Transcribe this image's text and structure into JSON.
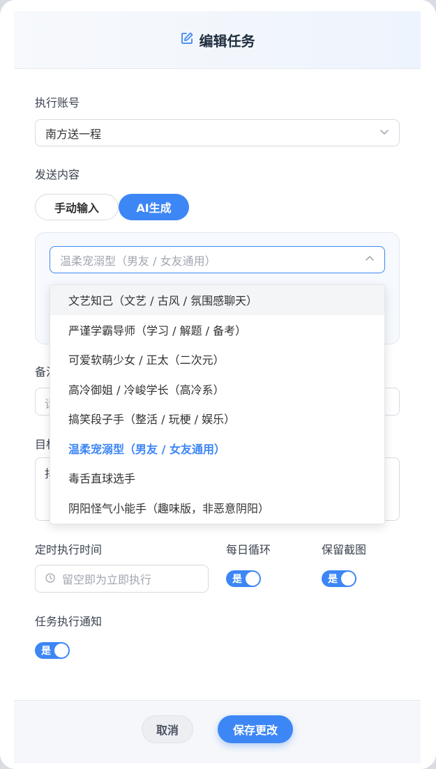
{
  "dialog": {
    "title": "编辑任务",
    "icon": "edit-icon"
  },
  "account": {
    "label": "执行账号",
    "value": "南方送一程"
  },
  "content": {
    "label": "发送内容",
    "tabs": [
      "手动输入",
      "AI生成"
    ],
    "active_tab": "AI生成"
  },
  "ai_style": {
    "placeholder": "温柔宠溺型（男友 / 女友通用）",
    "options": [
      "文艺知己（文艺 / 古风 / 氛围感聊天）",
      "严谨学霸导师（学习 / 解题 / 备考）",
      "可爱软萌少女 / 正太（二次元）",
      "高冷御姐 / 冷峻学长（高冷系）",
      "搞笑段子手（整活 / 玩梗 / 娱乐）",
      "温柔宠溺型（男友 / 女友通用）",
      "毒舌直球选手",
      "阴阳怪气小能手（趣味版，非恶意阴阳）"
    ],
    "selected": "温柔宠溺型（男友 / 女友通用）",
    "hovered": "文艺知己（文艺 / 古风 / 氛围感聊天）"
  },
  "occluded": {
    "remark_label_partial": "备注",
    "remark_input_partial": "请",
    "target_label_partial": "目标",
    "target_input_partial": "抖"
  },
  "schedule": {
    "label": "定时执行时间",
    "placeholder": "留空即为立即执行",
    "daily_loop_label": "每日循环",
    "daily_loop_value": "是",
    "keep_screenshot_label": "保留截图",
    "keep_screenshot_value": "是"
  },
  "notify": {
    "label": "任务执行通知",
    "value": "是"
  },
  "footer": {
    "cancel": "取消",
    "save": "保存更改"
  },
  "colors": {
    "accent": "#3d86f5",
    "text": "#303133",
    "placeholder": "#a0a6b0"
  }
}
